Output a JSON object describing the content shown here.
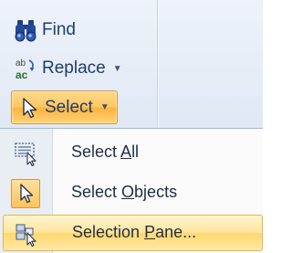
{
  "ribbon": {
    "find": {
      "label": "Find",
      "icon": "binoculars-icon"
    },
    "replace": {
      "label": "Replace",
      "icon": "replace-abc-icon",
      "dropdown_icon": "caret-down-icon"
    },
    "select": {
      "label": "Select",
      "icon": "pointer-arrow-icon",
      "dropdown_icon": "caret-down-icon",
      "state": "pressed"
    }
  },
  "menu": {
    "items": [
      {
        "pre": "Select ",
        "key": "A",
        "post": "ll",
        "icon": "select-all-icon",
        "highlighted": false
      },
      {
        "pre": "Select ",
        "key": "O",
        "post": "bjects",
        "icon": "select-objects-icon",
        "highlighted": false,
        "checked": true
      },
      {
        "pre": "Selection ",
        "key": "P",
        "post": "ane...",
        "icon": "selection-pane-icon",
        "highlighted": true
      }
    ]
  },
  "colors": {
    "accent_orange": "#ffc865",
    "hover_yellow": "#ffe59b",
    "ribbon_bg": "#e6edf7",
    "text": "#1e3d6b"
  }
}
